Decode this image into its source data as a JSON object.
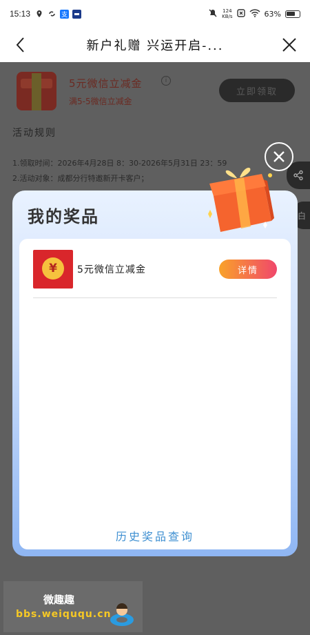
{
  "status_bar": {
    "time": "15:13",
    "speed_value": "124",
    "speed_unit": "KB/s",
    "battery": "63%"
  },
  "navbar": {
    "title": "新户礼赠 兴运开启-..."
  },
  "background_page": {
    "coupon_title": "5元微信立减金",
    "coupon_info_symbol": "i",
    "coupon_condition": "满5-5微信立减金",
    "claim_button": "立即领取",
    "rules_title": "活动规则",
    "rules": [
      "1.领取时间：2026年4月28日 8：30-2026年5月31日 23：59",
      "2.活动对象：成都分行特邀新开卡客户；"
    ],
    "side_tab_text": "白"
  },
  "modal": {
    "heading": "我的奖品",
    "prize": {
      "coin_symbol": "¥",
      "name": "5元微信立减金",
      "detail_button": "详情"
    },
    "history_link": "历史奖品查询"
  },
  "watermark": {
    "title": "微趣趣",
    "url": "bbs.weiququ.cn"
  },
  "colors": {
    "accent_gradient_start": "#f9a22a",
    "accent_gradient_end": "#f0476b",
    "history_link": "#3e8fd1",
    "red_envelope": "#d9262b"
  },
  "icons": [
    "location-icon",
    "loop-icon",
    "alipay-icon",
    "app-icon",
    "mute-bell-icon",
    "sim-icon",
    "wifi-icon",
    "battery-icon",
    "back-icon",
    "close-icon",
    "info-icon",
    "share-icon",
    "gift-box-icon",
    "modal-close-icon"
  ]
}
